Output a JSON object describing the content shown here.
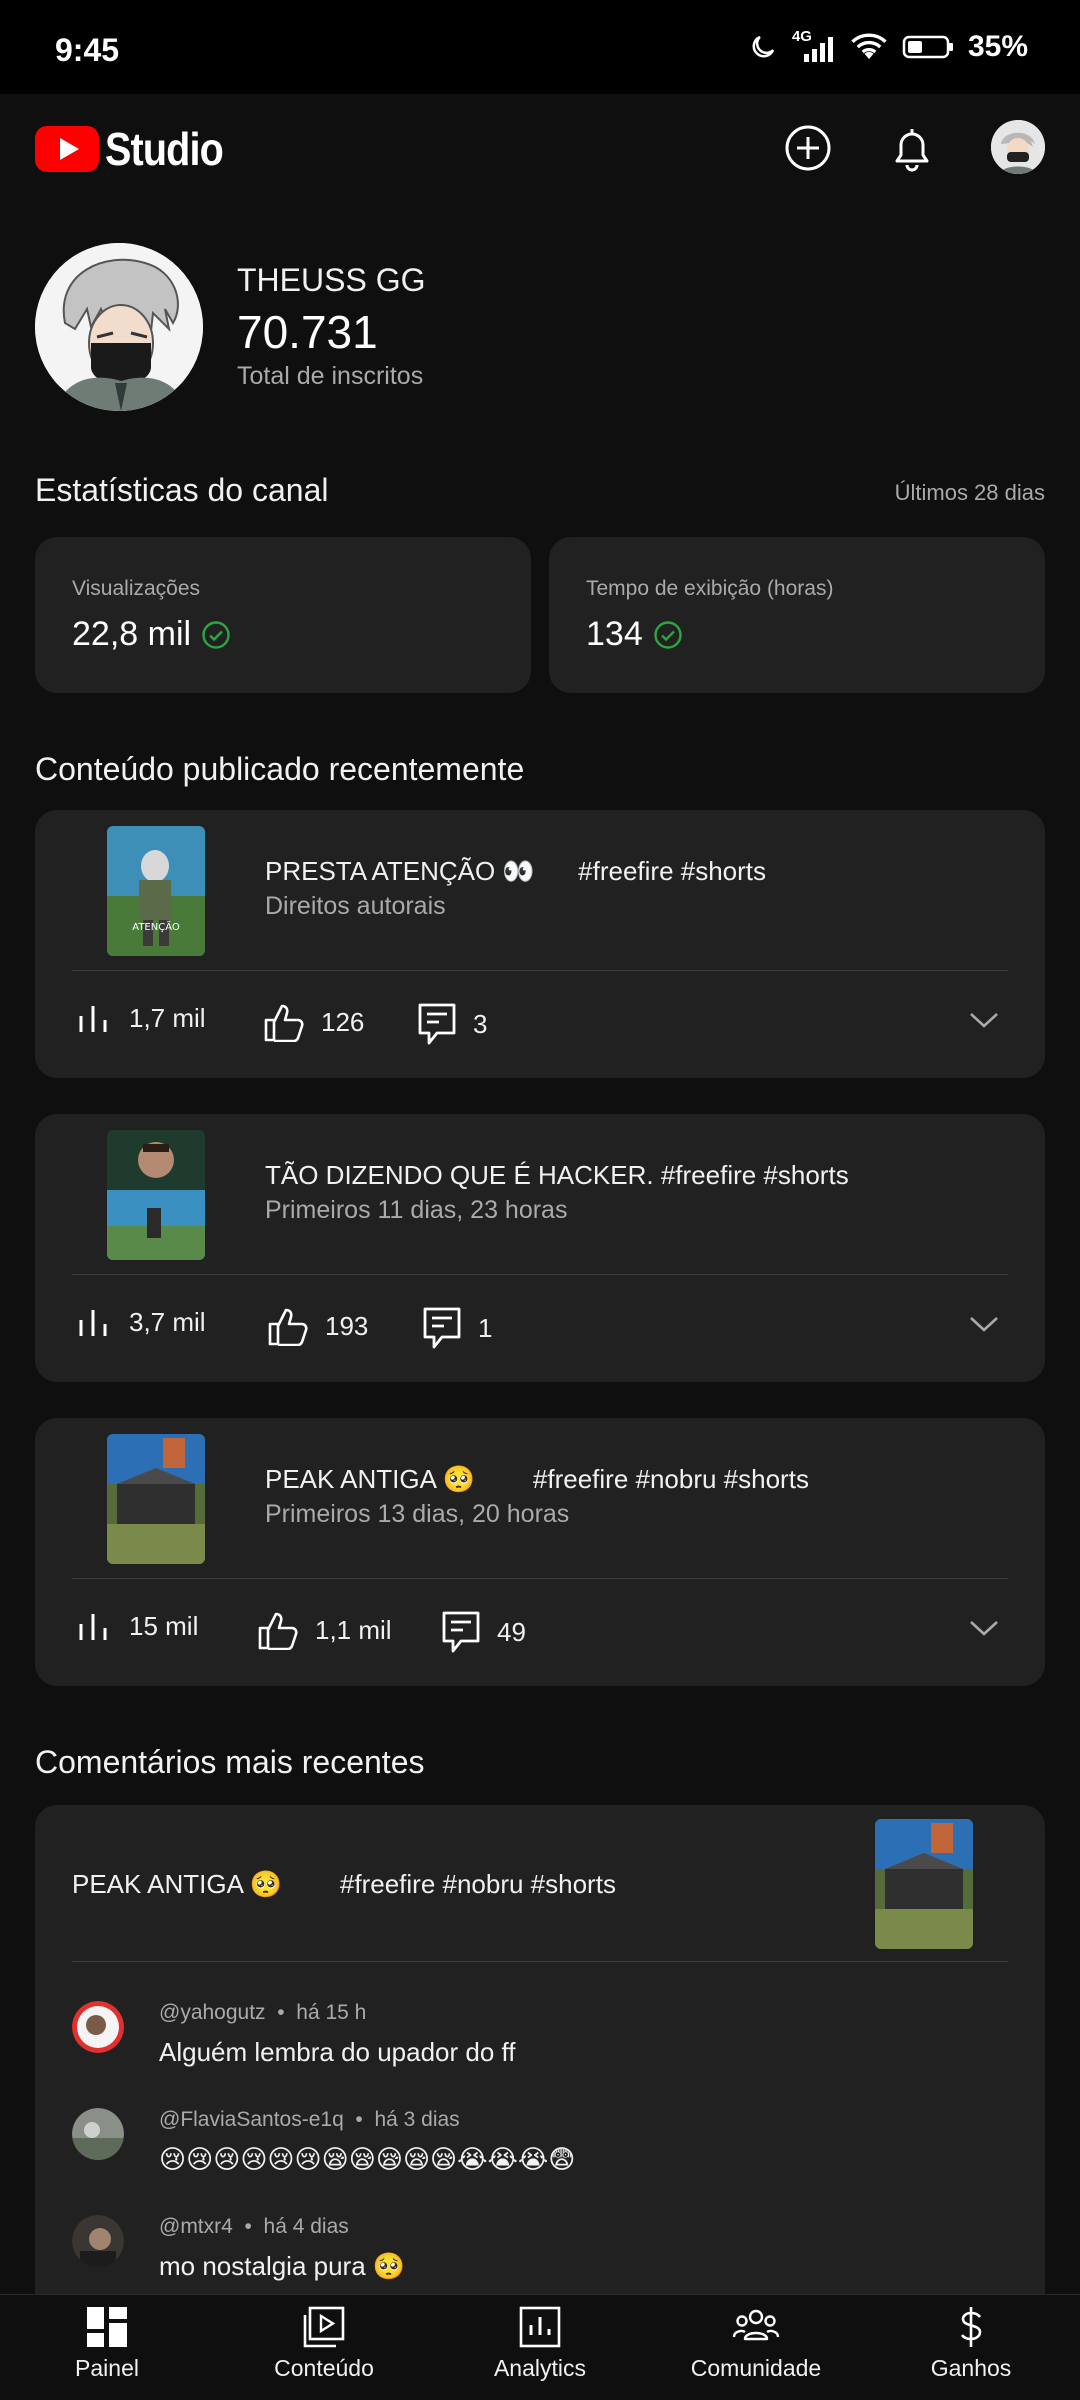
{
  "status_bar": {
    "time": "9:45",
    "network": "4G",
    "battery": "35%"
  },
  "header": {
    "logo_text": "Studio",
    "add_icon": "add-circle-icon",
    "bell_icon": "bell-icon"
  },
  "profile": {
    "channel_name": "THEUSS GG",
    "subscribers": "70.731",
    "subscribers_label": "Total de inscritos"
  },
  "stats": {
    "title": "Estatísticas do canal",
    "period": "Últimos 28 dias",
    "cards": [
      {
        "label": "Visualizações",
        "value": "22,8 mil"
      },
      {
        "label": "Tempo de exibição (horas)",
        "value": "134"
      }
    ]
  },
  "recent": {
    "title": "Conteúdo publicado recentemente",
    "videos": [
      {
        "title": "PRESTA ATENÇÃO 👀      #freefire #shorts",
        "subtitle": "Direitos autorais",
        "views": "1,7 mil",
        "likes": "126",
        "comments": "3"
      },
      {
        "title": "TÃO DIZENDO QUE É HACKER. #freefire #shorts",
        "subtitle": "Primeiros 11 dias, 23 horas",
        "views": "3,7 mil",
        "likes": "193",
        "comments": "1"
      },
      {
        "title": "PEAK ANTIGA 🥺        #freefire #nobru #shorts",
        "subtitle": "Primeiros 13 dias, 20 horas",
        "views": "15 mil",
        "likes": "1,1 mil",
        "comments": "49"
      }
    ]
  },
  "comments": {
    "title": "Comentários mais recentes",
    "video_title": "PEAK ANTIGA 🥺        #freefire #nobru #shorts",
    "items": [
      {
        "author": "@yahogutz",
        "time": "há 15 h",
        "text": "Alguém lembra do upador do ff"
      },
      {
        "author": "@FlaviaSantos-e1q",
        "time": "há 3 dias",
        "text": "😢😢😢😢😢😢😪😪😪😪😪😭😭😭😨"
      },
      {
        "author": "@mtxr4",
        "time": "há 4 dias",
        "text": "mo nostalgia pura 🥺"
      }
    ]
  },
  "nav": [
    {
      "label": "Painel",
      "icon": "dashboard-icon"
    },
    {
      "label": "Conteúdo",
      "icon": "content-icon"
    },
    {
      "label": "Analytics",
      "icon": "analytics-icon"
    },
    {
      "label": "Comunidade",
      "icon": "community-icon"
    },
    {
      "label": "Ganhos",
      "icon": "dollar-icon"
    }
  ],
  "colors": {
    "background": "#0f0f0f",
    "card": "#212121",
    "youtube_red": "#ff0000",
    "check_green": "#2ba640",
    "muted_text": "#aaaaaa"
  }
}
